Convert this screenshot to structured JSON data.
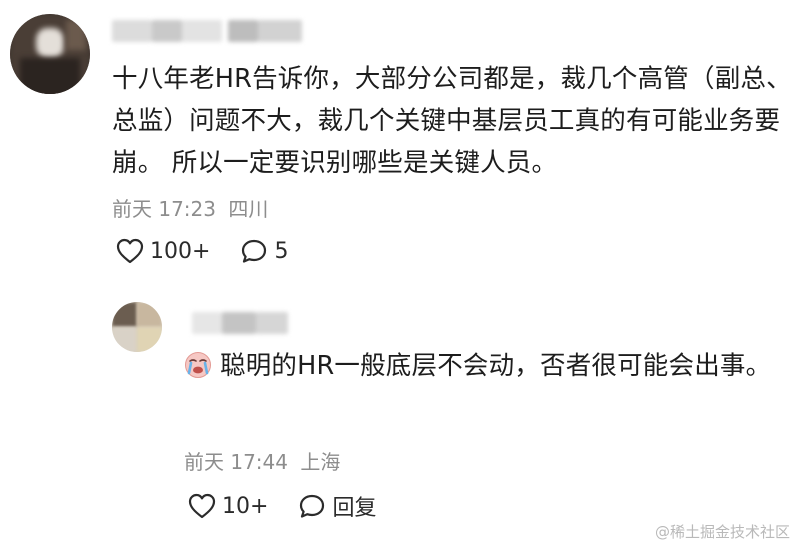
{
  "main_comment": {
    "text": "十八年老HR告诉你，大部分公司都是，裁几个高管（副总、总监）问题不大，裁几个关键中基层员工真的有可能业务要崩。 所以一定要识别哪些是关键人员。",
    "time": "前天 17:23",
    "location": "四川",
    "like_count": "100+",
    "reply_count": "5",
    "like_icon": "heart-outline",
    "comment_icon": "speech-bubble-outline"
  },
  "reply": {
    "text": "聪明的HR一般底层不会动，否者很可能会出事。",
    "emoji": "crying-face",
    "time": "前天 17:44",
    "location": "上海",
    "like_count": "10+",
    "reply_label": "回复"
  },
  "watermark": "@稀土掘金技术社区",
  "colors": {
    "text": "#1d1d1d",
    "meta": "#8d8d8d",
    "watermark": "#b9b9b9"
  }
}
